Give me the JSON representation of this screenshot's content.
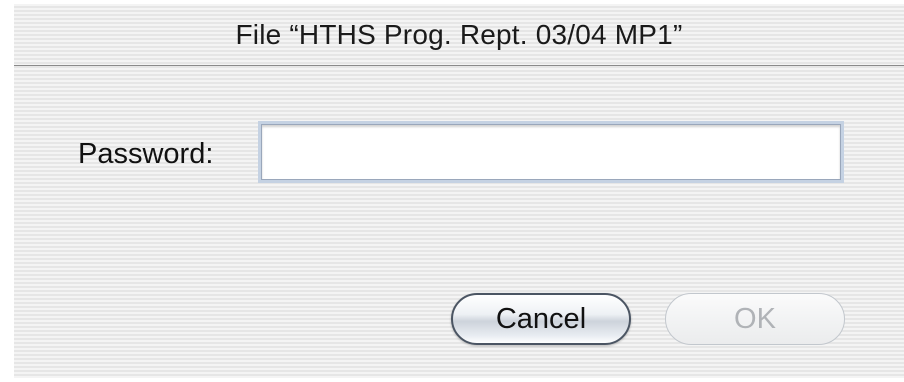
{
  "dialog": {
    "title": "File “HTHS Prog. Rept. 03/04 MP1”",
    "password_label": "Password:",
    "password_value": "",
    "cancel_label": "Cancel",
    "ok_label": "OK",
    "ok_enabled": false
  }
}
